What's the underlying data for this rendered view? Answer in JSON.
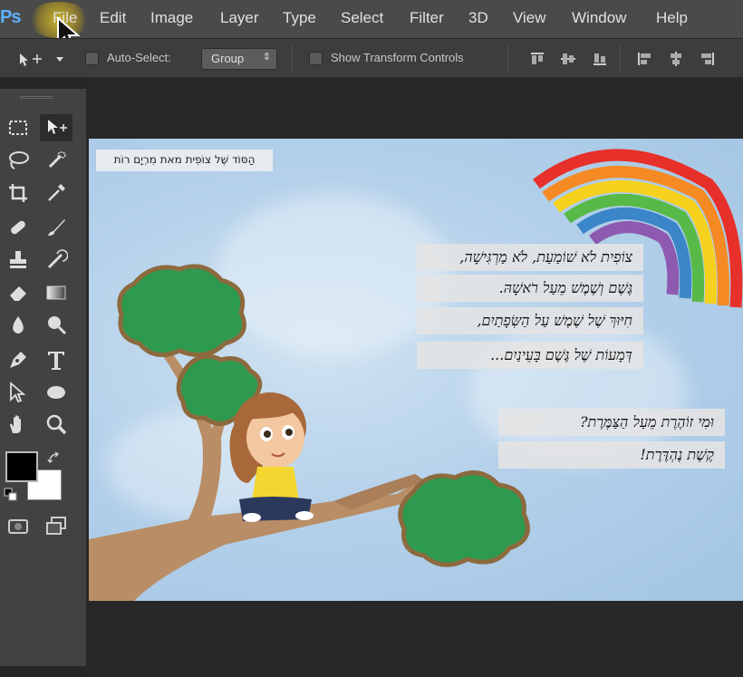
{
  "app": {
    "logo": "Ps"
  },
  "menu": {
    "items": [
      "File",
      "Edit",
      "Image",
      "Layer",
      "Type",
      "Select",
      "Filter",
      "3D",
      "View",
      "Window",
      "Help"
    ]
  },
  "options_bar": {
    "auto_select_label": "Auto-Select:",
    "group_value": "Group",
    "transform_label": "Show Transform Controls"
  },
  "toolbox": {
    "tools": [
      "move-tool",
      "marquee-tool",
      "lasso-tool",
      "quick-selection-tool",
      "crop-tool",
      "eyedropper-tool",
      "healing-brush-tool",
      "brush-tool",
      "clone-stamp-tool",
      "history-brush-tool",
      "eraser-tool",
      "gradient-tool",
      "blur-tool",
      "dodge-tool",
      "pen-tool",
      "type-tool",
      "path-selection-tool",
      "shape-tool",
      "hand-tool",
      "zoom-tool"
    ],
    "foreground_color": "#000000",
    "background_color": "#ffffff"
  },
  "canvas": {
    "credit": "הַסּוֹד שֶׁל צוֹפִית מאת מִרְיָם רוֹת",
    "verses": [
      "צוֹפִית לֹא שׁוֹמַעַת, לֹא מַרְגִּישָׁה,",
      "גֶּשֶׁם וְשֶׁמֶשׁ מֵעַל רֹאשָׁהּ.",
      "חִיּוּךְ שֶׁל שֶׁמֶשׁ עַל הַשְּׂפָתַיִם,",
      "דְּמָעוֹת שֶׁל גֶּשֶׁם בָּעֵינַיִם..."
    ],
    "verses2": [
      "וּמִי זוֹהֶרֶת מֵעַל הַצַּמֶּרֶת?",
      "קֶשֶׁת נֶהְדֶּרֶת!"
    ],
    "rainbow_colors": [
      "#e8302a",
      "#f58a24",
      "#f6d21e",
      "#57b947",
      "#3a86c8",
      "#8d5ab0"
    ]
  }
}
